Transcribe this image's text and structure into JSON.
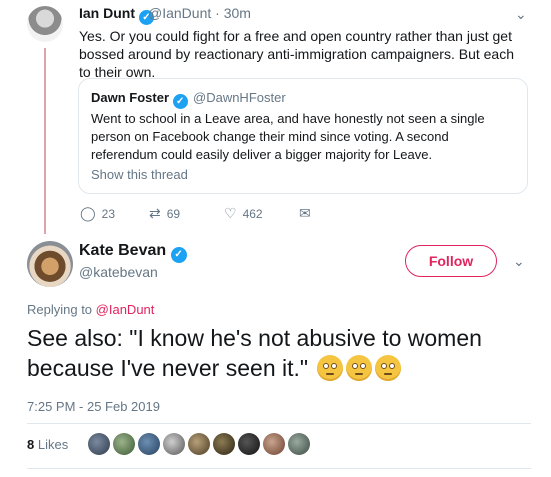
{
  "tweet1": {
    "name": "Ian Dunt",
    "handle": "@IanDunt · 30m",
    "text": "Yes. Or you could fight for a free and open country rather than just get bossed around by reactionary anti-immigration campaigners. But each to their own.",
    "quote": {
      "name": "Dawn Foster",
      "handle": "@DawnHFoster",
      "text": "Went to school in a Leave area, and have honestly not seen a single person on Facebook change their mind since voting. A second referendum could easily deliver a bigger majority for Leave.",
      "show_thread": "Show this thread"
    },
    "replies": "23",
    "retweets": "69",
    "likes": "462"
  },
  "tweet2": {
    "name": "Kate Bevan",
    "handle": "@katebevan",
    "follow_label": "Follow",
    "replying_prefix": "Replying to ",
    "replying_to": "@IanDunt",
    "text": "See also: \"I know he's not abusive to women because I've never seen it.\"",
    "timestamp": "7:25 PM - 25 Feb 2019",
    "likes_count": "8",
    "likes_label": " Likes",
    "emoji": "face-with-rolling-eyes",
    "emoji_count": 3,
    "liker_avatar_count": 9
  },
  "icons": {
    "verified": "verified-check-icon",
    "reply": "reply-icon",
    "retweet": "retweet-icon",
    "like": "heart-icon",
    "message": "envelope-icon",
    "menu": "chevron-down-icon"
  },
  "colors": {
    "verified": "#1da1f2",
    "follow": "#e0245e",
    "thread_line": "#e0a3aa",
    "muted": "#657786"
  }
}
